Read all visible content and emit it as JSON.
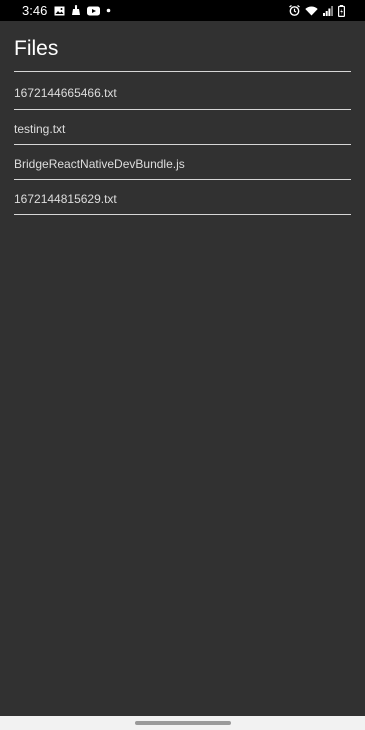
{
  "status_bar": {
    "time": "3:46",
    "left_icons": [
      "gallery-icon",
      "clipboard-icon",
      "youtube-icon",
      "notification-dot-icon"
    ],
    "right_icons": [
      "alarm-icon",
      "wifi-icon",
      "signal-icon",
      "battery-icon"
    ]
  },
  "header": {
    "title": "Files"
  },
  "files": [
    {
      "name": "1672144665466.txt"
    },
    {
      "name": "testing.txt"
    },
    {
      "name": "BridgeReactNativeDevBundle.js"
    },
    {
      "name": "1672144815629.txt"
    }
  ],
  "colors": {
    "background": "#313131",
    "status_bar": "#000000",
    "divider": "#d6d6d6",
    "title_text": "#ffffff",
    "item_text": "#dddddd",
    "nav_bar": "#f2f2f2"
  }
}
